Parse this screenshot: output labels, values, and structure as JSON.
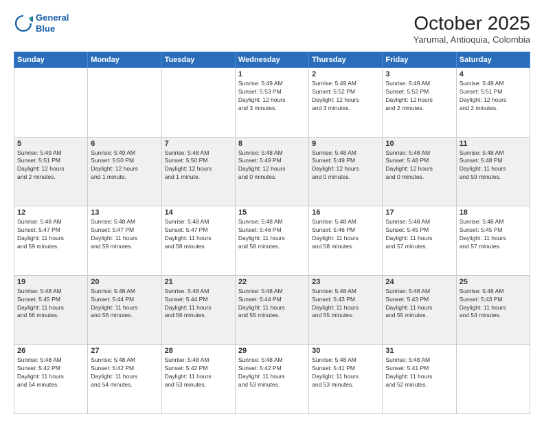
{
  "header": {
    "logo_line1": "General",
    "logo_line2": "Blue",
    "month": "October 2025",
    "location": "Yarumal, Antioquia, Colombia"
  },
  "weekdays": [
    "Sunday",
    "Monday",
    "Tuesday",
    "Wednesday",
    "Thursday",
    "Friday",
    "Saturday"
  ],
  "weeks": [
    [
      {
        "day": "",
        "info": ""
      },
      {
        "day": "",
        "info": ""
      },
      {
        "day": "",
        "info": ""
      },
      {
        "day": "1",
        "info": "Sunrise: 5:49 AM\nSunset: 5:53 PM\nDaylight: 12 hours\nand 3 minutes."
      },
      {
        "day": "2",
        "info": "Sunrise: 5:49 AM\nSunset: 5:52 PM\nDaylight: 12 hours\nand 3 minutes."
      },
      {
        "day": "3",
        "info": "Sunrise: 5:49 AM\nSunset: 5:52 PM\nDaylight: 12 hours\nand 2 minutes."
      },
      {
        "day": "4",
        "info": "Sunrise: 5:49 AM\nSunset: 5:51 PM\nDaylight: 12 hours\nand 2 minutes."
      }
    ],
    [
      {
        "day": "5",
        "info": "Sunrise: 5:49 AM\nSunset: 5:51 PM\nDaylight: 12 hours\nand 2 minutes."
      },
      {
        "day": "6",
        "info": "Sunrise: 5:49 AM\nSunset: 5:50 PM\nDaylight: 12 hours\nand 1 minute."
      },
      {
        "day": "7",
        "info": "Sunrise: 5:48 AM\nSunset: 5:50 PM\nDaylight: 12 hours\nand 1 minute."
      },
      {
        "day": "8",
        "info": "Sunrise: 5:48 AM\nSunset: 5:49 PM\nDaylight: 12 hours\nand 0 minutes."
      },
      {
        "day": "9",
        "info": "Sunrise: 5:48 AM\nSunset: 5:49 PM\nDaylight: 12 hours\nand 0 minutes."
      },
      {
        "day": "10",
        "info": "Sunrise: 5:48 AM\nSunset: 5:48 PM\nDaylight: 12 hours\nand 0 minutes."
      },
      {
        "day": "11",
        "info": "Sunrise: 5:48 AM\nSunset: 5:48 PM\nDaylight: 11 hours\nand 59 minutes."
      }
    ],
    [
      {
        "day": "12",
        "info": "Sunrise: 5:48 AM\nSunset: 5:47 PM\nDaylight: 11 hours\nand 59 minutes."
      },
      {
        "day": "13",
        "info": "Sunrise: 5:48 AM\nSunset: 5:47 PM\nDaylight: 11 hours\nand 59 minutes."
      },
      {
        "day": "14",
        "info": "Sunrise: 5:48 AM\nSunset: 5:47 PM\nDaylight: 11 hours\nand 58 minutes."
      },
      {
        "day": "15",
        "info": "Sunrise: 5:48 AM\nSunset: 5:46 PM\nDaylight: 11 hours\nand 58 minutes."
      },
      {
        "day": "16",
        "info": "Sunrise: 5:48 AM\nSunset: 5:46 PM\nDaylight: 11 hours\nand 58 minutes."
      },
      {
        "day": "17",
        "info": "Sunrise: 5:48 AM\nSunset: 5:45 PM\nDaylight: 11 hours\nand 57 minutes."
      },
      {
        "day": "18",
        "info": "Sunrise: 5:48 AM\nSunset: 5:45 PM\nDaylight: 11 hours\nand 57 minutes."
      }
    ],
    [
      {
        "day": "19",
        "info": "Sunrise: 5:48 AM\nSunset: 5:45 PM\nDaylight: 11 hours\nand 56 minutes."
      },
      {
        "day": "20",
        "info": "Sunrise: 5:48 AM\nSunset: 5:44 PM\nDaylight: 11 hours\nand 56 minutes."
      },
      {
        "day": "21",
        "info": "Sunrise: 5:48 AM\nSunset: 5:44 PM\nDaylight: 11 hours\nand 56 minutes."
      },
      {
        "day": "22",
        "info": "Sunrise: 5:48 AM\nSunset: 5:44 PM\nDaylight: 11 hours\nand 55 minutes."
      },
      {
        "day": "23",
        "info": "Sunrise: 5:48 AM\nSunset: 5:43 PM\nDaylight: 11 hours\nand 55 minutes."
      },
      {
        "day": "24",
        "info": "Sunrise: 5:48 AM\nSunset: 5:43 PM\nDaylight: 11 hours\nand 55 minutes."
      },
      {
        "day": "25",
        "info": "Sunrise: 5:48 AM\nSunset: 5:43 PM\nDaylight: 11 hours\nand 54 minutes."
      }
    ],
    [
      {
        "day": "26",
        "info": "Sunrise: 5:48 AM\nSunset: 5:42 PM\nDaylight: 11 hours\nand 54 minutes."
      },
      {
        "day": "27",
        "info": "Sunrise: 5:48 AM\nSunset: 5:42 PM\nDaylight: 11 hours\nand 54 minutes."
      },
      {
        "day": "28",
        "info": "Sunrise: 5:48 AM\nSunset: 5:42 PM\nDaylight: 11 hours\nand 53 minutes."
      },
      {
        "day": "29",
        "info": "Sunrise: 5:48 AM\nSunset: 5:42 PM\nDaylight: 11 hours\nand 53 minutes."
      },
      {
        "day": "30",
        "info": "Sunrise: 5:48 AM\nSunset: 5:41 PM\nDaylight: 11 hours\nand 53 minutes."
      },
      {
        "day": "31",
        "info": "Sunrise: 5:48 AM\nSunset: 5:41 PM\nDaylight: 11 hours\nand 52 minutes."
      },
      {
        "day": "",
        "info": ""
      }
    ]
  ]
}
